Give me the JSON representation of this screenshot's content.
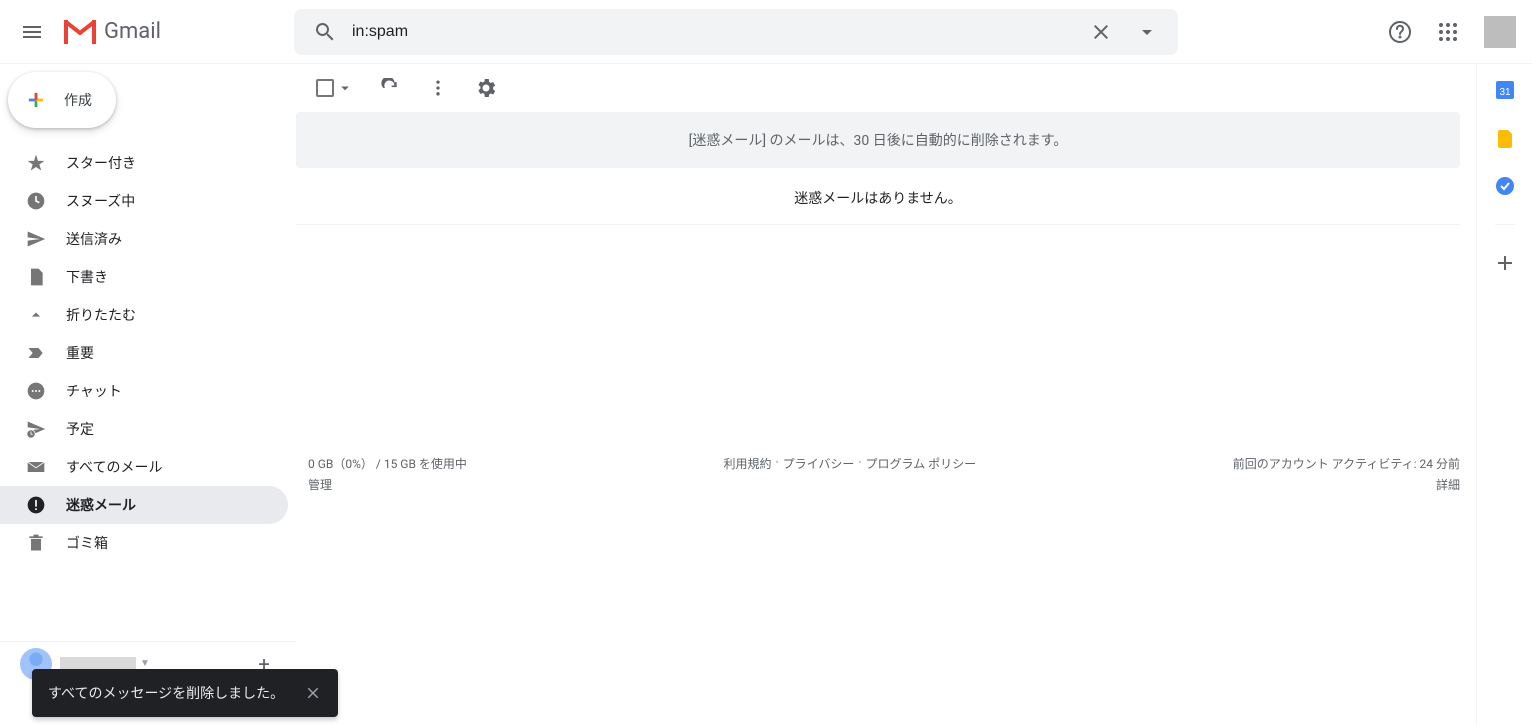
{
  "header": {
    "logo_text": "Gmail",
    "search_value": "in:spam"
  },
  "compose": {
    "label": "作成"
  },
  "sidebar": {
    "items": [
      {
        "label": "スター付き",
        "icon": "star"
      },
      {
        "label": "スヌーズ中",
        "icon": "clock"
      },
      {
        "label": "送信済み",
        "icon": "send"
      },
      {
        "label": "下書き",
        "icon": "draft"
      },
      {
        "label": "折りたたむ",
        "icon": "collapse"
      },
      {
        "label": "重要",
        "icon": "important"
      },
      {
        "label": "チャット",
        "icon": "chat"
      },
      {
        "label": "予定",
        "icon": "scheduled"
      },
      {
        "label": "すべてのメール",
        "icon": "allmail"
      },
      {
        "label": "迷惑メール",
        "icon": "spam",
        "active": true
      },
      {
        "label": "ゴミ箱",
        "icon": "trash"
      }
    ]
  },
  "spam_banner": "[迷惑メール] のメールは、30 日後に自動的に削除されます。",
  "empty_message": "迷惑メールはありません。",
  "footer": {
    "storage_used": "0 GB（0%）",
    "storage_sep": "/",
    "storage_total": "15 GB を使用中",
    "manage": "管理",
    "links": {
      "terms": "利用規約",
      "privacy": "プライバシー",
      "program": "プログラム ポリシー"
    },
    "activity": "前回のアカウント アクティビティ: 24 分前",
    "details": "詳細"
  },
  "toast": {
    "message": "すべてのメッセージを削除しました。"
  }
}
